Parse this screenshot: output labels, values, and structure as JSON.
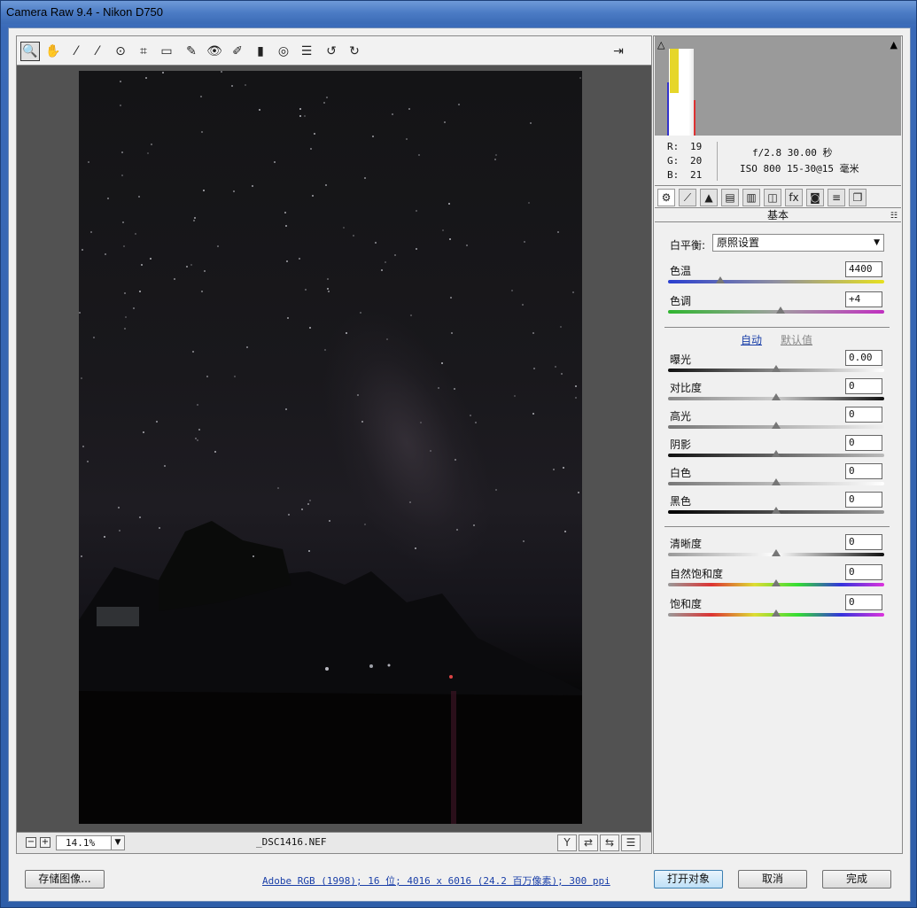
{
  "window": {
    "title": "Camera Raw 9.4 -  Nikon D750"
  },
  "toolbar": {
    "tools": [
      {
        "name": "zoom-tool",
        "icon": "🔍"
      },
      {
        "name": "hand-tool",
        "icon": "✋"
      },
      {
        "name": "white-balance-tool",
        "icon": "⁄"
      },
      {
        "name": "color-sampler-tool",
        "icon": "⁄"
      },
      {
        "name": "targeted-adjustment-tool",
        "icon": "⊙"
      },
      {
        "name": "crop-tool",
        "icon": "⌗"
      },
      {
        "name": "straighten-tool",
        "icon": "▭"
      },
      {
        "name": "spot-removal-tool",
        "icon": "✎"
      },
      {
        "name": "red-eye-tool",
        "icon": "👁"
      },
      {
        "name": "adjustment-brush-tool",
        "icon": "✐"
      },
      {
        "name": "graduated-filter-tool",
        "icon": "▮"
      },
      {
        "name": "radial-filter-tool",
        "icon": "◎"
      },
      {
        "name": "preferences-tool",
        "icon": "☰"
      },
      {
        "name": "rotate-left-tool",
        "icon": "↺"
      },
      {
        "name": "rotate-right-tool",
        "icon": "↻"
      }
    ],
    "export_icon": "⇥"
  },
  "footer_bar": {
    "zoom_minus": "−",
    "zoom_plus": "+",
    "zoom": "14.1%",
    "zoom_arrow": "▼",
    "filename": "_DSC1416.NEF",
    "view_buttons": [
      "Y",
      "⇄",
      "⇆",
      "☰"
    ]
  },
  "readout": {
    "r_label": "R:",
    "r": "19",
    "g_label": "G:",
    "g": "20",
    "b_label": "B:",
    "b": "21",
    "exif_line1": "f/2.8  30.00 秒",
    "exif_line2": "ISO 800  15-30@15 毫米"
  },
  "histogram": {
    "shadow_clip_icon": "△",
    "highlight_clip_icon": "▲"
  },
  "tabs": [
    "⚙",
    "⟋",
    "▲",
    "▤",
    "▥",
    "◫",
    "fx",
    "◙",
    "≡",
    "❐"
  ],
  "panel": {
    "section_title": "基本",
    "menu_icon": "☷",
    "wb_label": "白平衡:",
    "wb_value": "原照设置",
    "wb_arrow": "▼",
    "auto": "自动",
    "default": "默认值",
    "sliders_top": [
      {
        "label": "色温",
        "value": "4400",
        "pos": 0.24
      },
      {
        "label": "色调",
        "value": "+4",
        "pos": 0.52
      }
    ],
    "sliders_tone": [
      {
        "label": "曝光",
        "value": "0.00",
        "pos": 0.5
      },
      {
        "label": "对比度",
        "value": "0",
        "pos": 0.5
      },
      {
        "label": "高光",
        "value": "0",
        "pos": 0.5
      },
      {
        "label": "阴影",
        "value": "0",
        "pos": 0.5
      },
      {
        "label": "白色",
        "value": "0",
        "pos": 0.5
      },
      {
        "label": "黑色",
        "value": "0",
        "pos": 0.5
      }
    ],
    "sliders_presence": [
      {
        "label": "清晰度",
        "value": "0",
        "pos": 0.5
      },
      {
        "label": "自然饱和度",
        "value": "0",
        "pos": 0.5
      },
      {
        "label": "饱和度",
        "value": "0",
        "pos": 0.5
      }
    ]
  },
  "footer": {
    "save_label": "存储图像...",
    "workflow_options": "Adobe RGB (1998); 16 位; 4016 x 6016 (24.2 百万像素); 300 ppi",
    "open_label": "打开对象",
    "cancel_label": "取消",
    "done_label": "完成"
  }
}
